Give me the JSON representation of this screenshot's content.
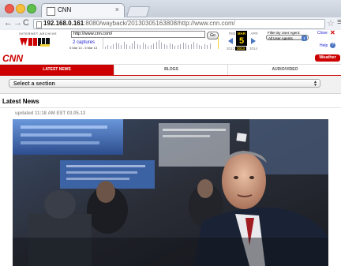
{
  "browser": {
    "tab_title": "CNN",
    "tab_close": "×",
    "url_host": "192.168.0.161",
    "url_rest": ":8080/wayback/20130305163808/http://www.cnn.com/",
    "nav_back": "←",
    "nav_forward": "→",
    "nav_reload": "C",
    "bookmark_star": "☆",
    "menu": "≡"
  },
  "wayback": {
    "logo_caption": "INTERNET ARCHIVE",
    "url_value": "http://www.cnn.com/",
    "go_label": "Go",
    "captures_label": "2 captures",
    "captures_range": "5 Mar 13 - 5 Mar 13",
    "month_prev": "FEB",
    "month_current": "MAR",
    "month_next": "APR",
    "day": "5",
    "year_prev": "2012",
    "year_current": "2013",
    "year_next": "2014",
    "filter_label": "Filter By User Agent:",
    "filter_value": "All User Agents",
    "close_label": "Close",
    "close_icon": "✕",
    "help_label": "Help",
    "help_icon": "?"
  },
  "cnn": {
    "logo_text": "CNN",
    "weather_label": "Weather",
    "nav": [
      "LATEST NEWS",
      "BLOGS",
      "AUDIO/VIDEO"
    ],
    "section_select": "Select a section",
    "section_title": "Latest News",
    "updated_text": "updated 11:18 AM EST 03.05.13"
  },
  "colors": {
    "cnn_red": "#cc0000",
    "wayback_yellow": "#ffd700",
    "wayback_blue": "#4b77c2",
    "link_blue": "#1a1ad0"
  }
}
